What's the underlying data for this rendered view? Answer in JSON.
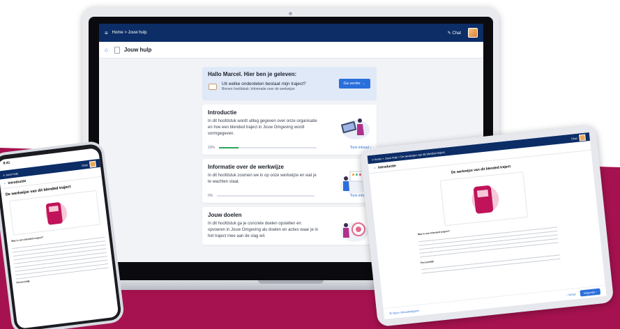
{
  "laptop": {
    "topbar": {
      "menu_icon": "menu-icon",
      "breadcrumb": "Home  >  Jouw hulp",
      "chat_label": "Chat"
    },
    "subheader": {
      "title": "Jouw hulp"
    },
    "welcome": {
      "heading": "Hallo Marcel. Hier ben je geleven:",
      "question": "Uit welke onderdelen bestaat mijn traject?",
      "subtext": "Binnen hoofdstuk: Informatie over de werkwijze",
      "button": "Ga verder"
    },
    "cards": [
      {
        "title": "Introductie",
        "description": "In dit hoofdstuk wordt uitleg gegeven over onze organisatie en hoe een blended traject in Jouw Omgeving wordt vormgegeven.",
        "progress_label": "20%",
        "progress": 0.2,
        "link": "Toon inhoud"
      },
      {
        "title": "Informatie over de werkwijze",
        "description": "In dit hoofdstuk zoomen we in op onze werkwijze en wat je te wachten staat.",
        "progress_label": "0%",
        "progress": 0,
        "link": "Toon inhoud"
      },
      {
        "title": "Jouw doelen",
        "description": "In dit hoofdstuk ga je concrete doelen opstellen en opvoeren in Jouw Omgeving als doelen en acties waar je in het traject mee aan de slag wil."
      }
    ]
  },
  "phone": {
    "time": "9:41",
    "bar_label": "Jouw hulp",
    "chat_label": "Chat",
    "subheader": "Introductie",
    "heading": "De werkwijze van dit blended traject",
    "section": "Wat is een blended traject?",
    "footer_label": "Persoonlijk"
  },
  "tablet": {
    "breadcrumb": "Home  >  Jouw hulp  >  De werkwijze van dit blended traject",
    "chat_label": "Chat",
    "subheader": "Introductie",
    "heading": "De werkwijze van dit blended traject",
    "section": "Wat is een blended traject?",
    "section2": "Persoonlijk",
    "footer_left": "Open inhoudsopgave",
    "footer_prev": "Vorige",
    "footer_next": "Volgende"
  },
  "colors": {
    "navy": "#0c2d66",
    "blue": "#2a6fdb",
    "magenta": "#a5124f",
    "green": "#2aa55a"
  }
}
